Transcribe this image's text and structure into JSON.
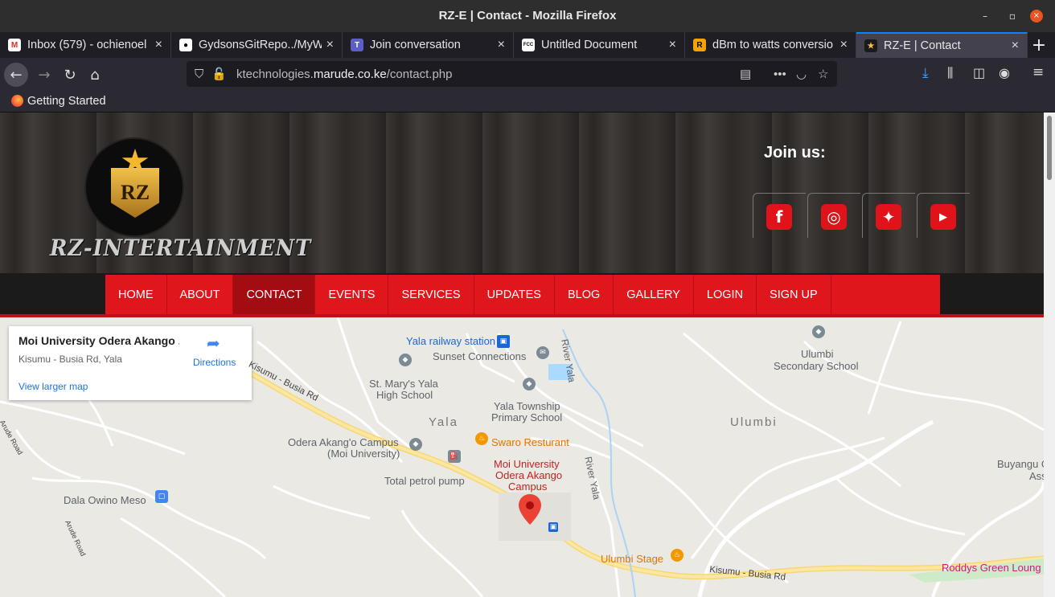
{
  "window": {
    "title": "RZ-E | Contact - Mozilla Firefox",
    "minimize": "–",
    "maximize": "▫",
    "close": "×"
  },
  "tabs": [
    {
      "label": "Inbox (579) - ochienoel",
      "icon": "gmail-icon",
      "color": "#ffffff",
      "glyph": "M",
      "glyph_color": "#d93025"
    },
    {
      "label": "GydsonsGitRepo../MyW",
      "icon": "github-icon",
      "color": "#ffffff",
      "glyph": "●",
      "glyph_color": "#000000"
    },
    {
      "label": "Join conversation",
      "icon": "teams-icon",
      "color": "#5b5fc7",
      "glyph": "T",
      "glyph_color": "#ffffff"
    },
    {
      "label": "Untitled Document",
      "icon": "document-icon",
      "color": "#ffffff",
      "glyph": "FCC",
      "glyph_color": "#000000"
    },
    {
      "label": "dBm to watts conversio",
      "icon": "rapidtables-icon",
      "color": "#f5a300",
      "glyph": "R",
      "glyph_color": "#000000"
    },
    {
      "label": "RZ-E | Contact",
      "icon": "rz-icon",
      "color": "#1a1a1a",
      "glyph": "★",
      "glyph_color": "#f2c14a",
      "active": true
    }
  ],
  "tab_close": "×",
  "new_tab": "+",
  "nav": {
    "back": "←",
    "forward": "→",
    "reload": "↻",
    "home": "⌂",
    "url_prefix": "ktechnologies.",
    "url_host": "marude.co.ke",
    "url_path": "/contact.php"
  },
  "bookmarks": [
    {
      "label": "Getting Started"
    }
  ],
  "site": {
    "brand_initials": "RZ",
    "logo_text": "RZ-INTERTAINMENT",
    "join_us": "Join us:",
    "social": [
      {
        "name": "facebook",
        "glyph": "f"
      },
      {
        "name": "instagram",
        "glyph": "◎"
      },
      {
        "name": "twitter",
        "glyph": "✦"
      },
      {
        "name": "youtube",
        "glyph": "▶"
      }
    ],
    "menu": [
      "HOME",
      "ABOUT",
      "CONTACT",
      "EVENTS",
      "SERVICES",
      "UPDATES",
      "BLOG",
      "GALLERY",
      "LOGIN",
      "SIGN UP"
    ],
    "menu_active": "CONTACT"
  },
  "map": {
    "card_title": "Moi University Odera Akango ...",
    "card_address": "Kisumu - Busia Rd, Yala",
    "directions": "Directions",
    "larger_map": "View larger map",
    "labels": {
      "yala_station": "Yala railway station",
      "sunset": "Sunset Connections",
      "river_yala_1": "River Yala",
      "ulumbi_school_1": "Ulumbi",
      "ulumbi_school_2": "Secondary School",
      "st_marys_1": "St. Mary's Yala",
      "st_marys_2": "High School",
      "township_1": "Yala Township",
      "township_2": "Primary School",
      "yala": "Yala",
      "ulumbi": "Ulumbi",
      "odera_1": "Odera Akang'o Campus",
      "odera_2": "(Moi University)",
      "swaro": "Swaro Resturant",
      "moi_1": "Moi University",
      "moi_2": "Odera Akango",
      "moi_3": "Campus",
      "total": "Total petrol pump",
      "river_yala_2": "River Yala",
      "buyangu_1": "Buyangu G",
      "buyangu_2": "Ass",
      "dala": "Dala Owino Meso",
      "ulumbi_stage": "Ulumbi Stage",
      "roddys": "Roddys Green Loung",
      "road_busia_1": "Kisumu - Busia Rd",
      "road_busia_2": "Kisumu - Busia Rd",
      "arude_1": "Arude Road",
      "arude_2": "Arude Road"
    }
  }
}
